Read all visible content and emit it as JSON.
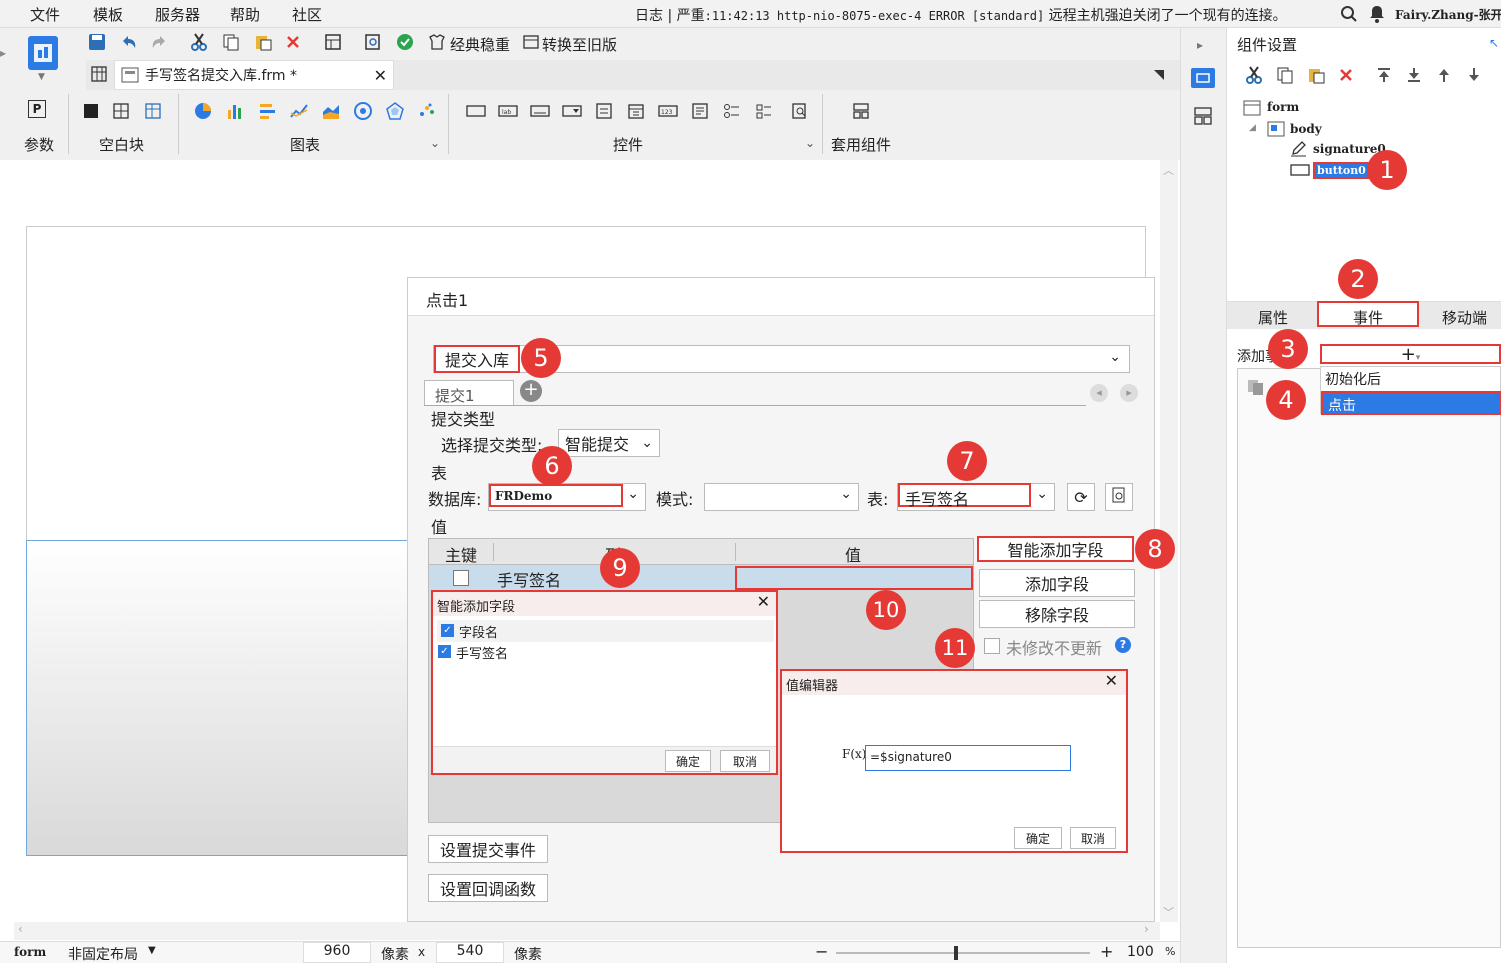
{
  "menu": {
    "items": [
      "文件",
      "模板",
      "服务器",
      "帮助",
      "社区"
    ]
  },
  "log": {
    "label": "日志",
    "sep": "|",
    "level": "严重",
    "message_mono": ":11:42:13 http-nio-8075-exec-4 ERROR [standard]",
    "message_zh": "远程主机强迫关闭了一个现有的连接。"
  },
  "user": {
    "name": "Fairy.Zhang-张开"
  },
  "toolbar": {
    "classic_theme": "经典稳重",
    "convert_old": "转换至旧版"
  },
  "file_tab": {
    "title": "手写签名提交入库.frm *"
  },
  "ribbon": {
    "params": "参数",
    "blank": "空白块",
    "chart": "图表",
    "controls": "控件",
    "package": "套用组件"
  },
  "dialog": {
    "title": "点击1",
    "submit_action": "提交入库",
    "tab": "提交1",
    "submit_type_section": "提交类型",
    "submit_type_label": "选择提交类型:",
    "submit_type_value": "智能提交",
    "table_section": "表",
    "database_label": "数据库:",
    "database_value": "FRDemo",
    "mode_label": "模式:",
    "mode_value": "",
    "table_label": "表:",
    "table_value": "手写签名",
    "value_section": "值",
    "columns": [
      "主键",
      "列",
      "值"
    ],
    "row": {
      "column": "手写签名",
      "value": ""
    },
    "smart_add_btn": "智能添加字段",
    "add_field_btn": "添加字段",
    "remove_field_btn": "移除字段",
    "no_update_label": "未修改不更新",
    "set_submit_event": "设置提交事件",
    "set_callback": "设置回调函数"
  },
  "smart_add_dialog": {
    "title": "智能添加字段",
    "header": "字段名",
    "items": [
      "手写签名"
    ],
    "ok": "确定",
    "cancel": "取消"
  },
  "value_editor": {
    "title": "值编辑器",
    "fx": "F(x)",
    "formula": "=$signature0",
    "ok": "确定",
    "cancel": "取消"
  },
  "right_panel": {
    "title": "组件设置",
    "tree": {
      "form": "form",
      "body": "body",
      "signature": "signature0",
      "button": "button0"
    },
    "tabs": [
      "属性",
      "事件",
      "移动端"
    ],
    "add_label": "添加事",
    "event_menu": [
      "初始化后",
      "点击"
    ]
  },
  "badges": [
    "1",
    "2",
    "3",
    "4",
    "5",
    "6",
    "7",
    "8",
    "9",
    "10",
    "11"
  ],
  "status": {
    "form": "form",
    "layout": "非固定布局",
    "width": "960",
    "unit1": "像素",
    "x": "x",
    "height": "540",
    "unit2": "像素",
    "zoom": "100",
    "pct": "%"
  },
  "colors": {
    "highlight": "#2c7be5",
    "badge": "#e53935",
    "selected_row": "#c8dcec"
  }
}
